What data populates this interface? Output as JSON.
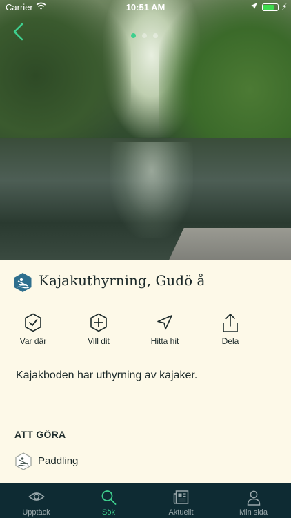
{
  "status_bar": {
    "carrier": "Carrier",
    "time": "10:51 AM"
  },
  "hero": {
    "image_icon": "river-photo",
    "page_count": 3,
    "active_page": 1
  },
  "place": {
    "title": "Kajakuthyrning, Gudö å",
    "category_icon": "kayak-icon",
    "description": "Kajakboden har uthyrning av kajaker."
  },
  "actions": [
    {
      "label": "Var där",
      "icon": "check-badge-icon"
    },
    {
      "label": "Vill dit",
      "icon": "plus-badge-icon"
    },
    {
      "label": "Hitta hit",
      "icon": "navigation-arrow-icon"
    },
    {
      "label": "Dela",
      "icon": "share-icon"
    }
  ],
  "todo": {
    "heading": "ATT GÖRA",
    "items": [
      {
        "label": "Paddling",
        "icon": "paddling-icon"
      }
    ]
  },
  "tabbar": {
    "active": "Sök",
    "items": [
      {
        "label": "Upptäck",
        "icon": "eye-icon"
      },
      {
        "label": "Sök",
        "icon": "search-icon"
      },
      {
        "label": "Aktuellt",
        "icon": "news-icon"
      },
      {
        "label": "Min sida",
        "icon": "person-icon"
      }
    ]
  },
  "colors": {
    "accent": "#3ecf8e",
    "background": "#FDF9E8",
    "tabbar": "#0e2b33",
    "text": "#1c2a2a",
    "badge": "#2e6f8e"
  }
}
